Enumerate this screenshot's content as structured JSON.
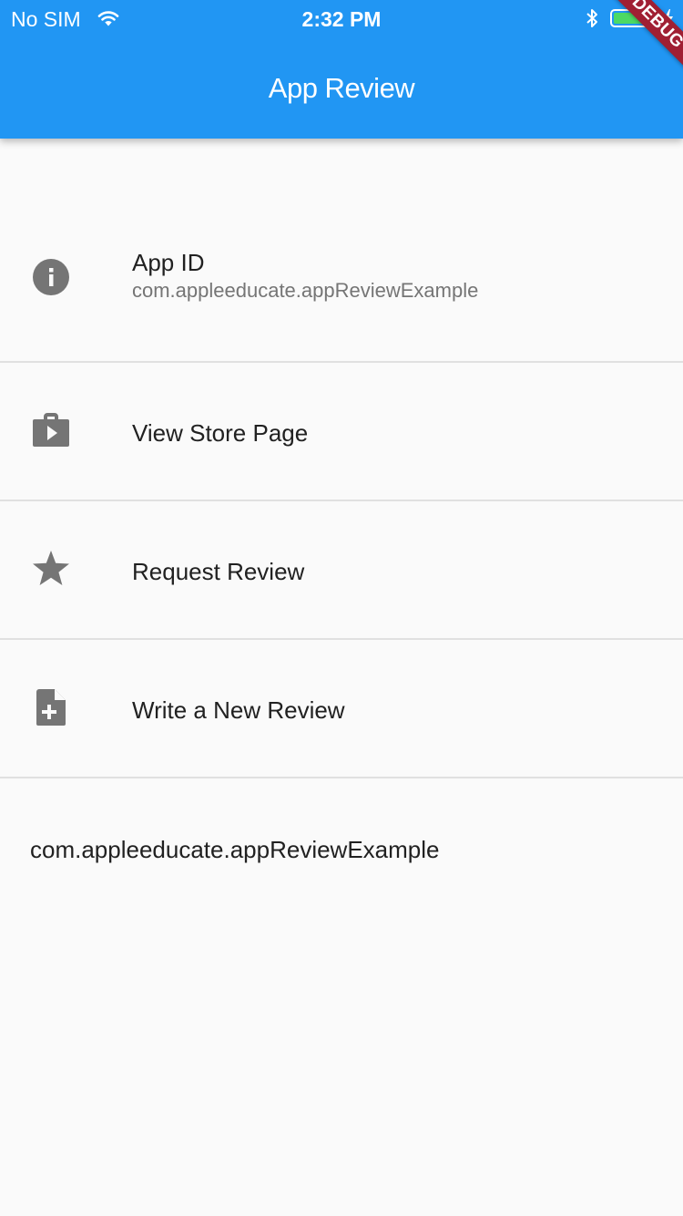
{
  "status_bar": {
    "carrier": "No SIM",
    "time": "2:32 PM",
    "wifi_icon": "wifi-icon",
    "bluetooth_icon": "bluetooth-icon",
    "battery_icon": "battery-icon",
    "charging_icon": "charging-bolt-icon"
  },
  "app_bar": {
    "title": "App Review",
    "debug_banner": "DEBUG",
    "color": "#2196f3"
  },
  "list": {
    "items": [
      {
        "icon": "info-icon",
        "title": "App ID",
        "subtitle": "com.appleeducate.appReviewExample"
      },
      {
        "icon": "shop-icon",
        "title": "View Store Page"
      },
      {
        "icon": "star-icon",
        "title": "Request Review"
      },
      {
        "icon": "note-add-icon",
        "title": "Write a New Review"
      }
    ]
  },
  "output": {
    "text": "com.appleeducate.appReviewExample"
  },
  "colors": {
    "primary": "#2196f3",
    "icon": "#757575",
    "debug": "#a01f33",
    "battery": "#4cd964"
  }
}
